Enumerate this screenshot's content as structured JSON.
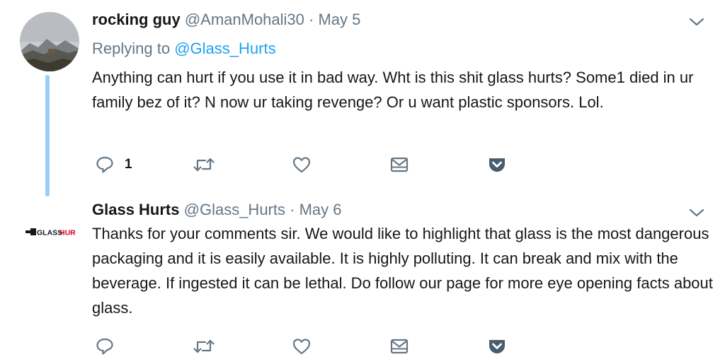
{
  "tweets": [
    {
      "name": "rocking guy",
      "handle": "@AmanMohali30",
      "separator": "·",
      "date": "May 5",
      "replying_label": "Replying to",
      "replying_to": "@Glass_Hurts",
      "text": "Anything can hurt if you use it in bad way. Wht is this shit glass hurts? Some1 died in ur family bez of it? N now ur taking revenge? Or u want plastic sponsors. Lol.",
      "reply_count": "1",
      "avatar_icon": "mountain-landscape-photo"
    },
    {
      "name": "Glass Hurts",
      "handle": "@Glass_Hurts",
      "separator": "·",
      "date": "May 6",
      "text": "Thanks for your comments sir. We would like to highlight that glass is the most dangerous packaging and it is easily available. It is highly polluting. It can break and mix with the beverage. If ingested it can be lethal. Do follow our page for more eye opening facts about glass.",
      "logo_text": "GLASS HURTS",
      "avatar_icon": "glass-hurts-logo"
    }
  ],
  "icons": [
    "reply-icon",
    "retweet-icon",
    "like-icon",
    "direct-message-icon",
    "pocket-save-icon",
    "chevron-down-icon"
  ],
  "colors": {
    "text": "#14171a",
    "secondary": "#657786",
    "link": "#1da1f2",
    "thread_line": "#9ad0f7",
    "pocket": "#4a5d6e",
    "logo_red": "#d0021b"
  }
}
